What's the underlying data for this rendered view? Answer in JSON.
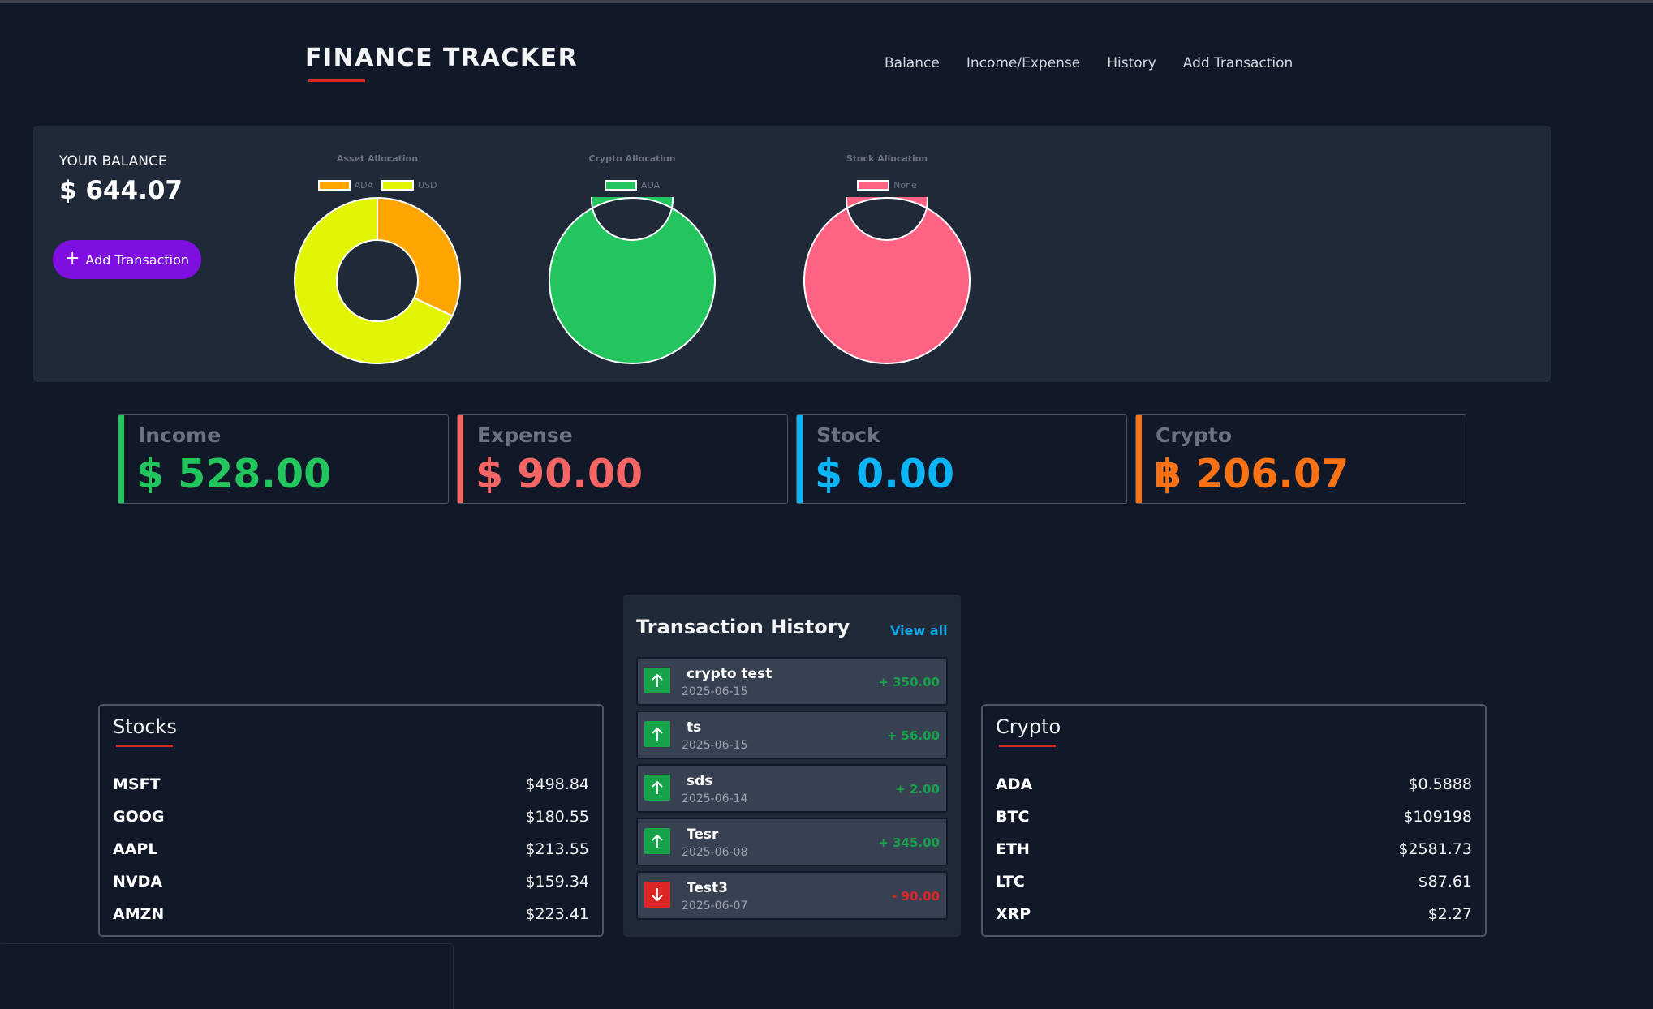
{
  "app": {
    "title": "FINANCE TRACKER"
  },
  "nav": {
    "items": [
      "Balance",
      "Income/Expense",
      "History",
      "Add Transaction"
    ]
  },
  "balance": {
    "label": "YOUR BALANCE",
    "value": "$ 644.07",
    "add_button_icon": "plus-icon",
    "add_button_label": "Add Transaction",
    "add_button_color": "#7e0fe0"
  },
  "chart_data": [
    {
      "type": "pie",
      "title": "Asset Allocation",
      "labels": [
        "ADA",
        "USD"
      ],
      "values": [
        206.07,
        437.99
      ],
      "colors": [
        "#ffa500",
        "#e1f505"
      ],
      "style": "doughnut",
      "legend": "top"
    },
    {
      "type": "pie",
      "title": "Crypto Allocation",
      "labels": [
        "ADA"
      ],
      "values": [
        206.07
      ],
      "colors": [
        "#22c55e"
      ],
      "style": "doughnut",
      "legend": "top"
    },
    {
      "type": "pie",
      "title": "Stock Allocation",
      "labels": [
        "None"
      ],
      "values": [
        1
      ],
      "colors": [
        "#ff6384"
      ],
      "style": "doughnut",
      "legend": "top"
    }
  ],
  "stats": [
    {
      "label": "Income",
      "value": "$ 528.00",
      "color": "#22c55e"
    },
    {
      "label": "Expense",
      "value": "$ 90.00",
      "color": "#f56565"
    },
    {
      "label": "Stock",
      "value": "$ 0.00",
      "color": "#0ab4f5"
    },
    {
      "label": "Crypto",
      "value": "฿ 206.07",
      "color": "#f97316"
    }
  ],
  "transactions": {
    "title": "Transaction History",
    "view_all": "View all",
    "items": [
      {
        "name": "crypto test",
        "date": "2025-06-15",
        "amount": "+ 350.00",
        "direction": "up",
        "icon": "arrow-up-icon"
      },
      {
        "name": "ts",
        "date": "2025-06-15",
        "amount": "+ 56.00",
        "direction": "up",
        "icon": "arrow-up-icon"
      },
      {
        "name": "sds",
        "date": "2025-06-14",
        "amount": "+ 2.00",
        "direction": "up",
        "icon": "arrow-up-icon"
      },
      {
        "name": "Tesr",
        "date": "2025-06-08",
        "amount": "+ 345.00",
        "direction": "up",
        "icon": "arrow-up-icon"
      },
      {
        "name": "Test3",
        "date": "2025-06-07",
        "amount": "- 90.00",
        "direction": "down",
        "icon": "arrow-down-icon"
      }
    ]
  },
  "stocks": {
    "title": "Stocks",
    "rows": [
      {
        "symbol": "MSFT",
        "price": "$498.84"
      },
      {
        "symbol": "GOOG",
        "price": "$180.55"
      },
      {
        "symbol": "AAPL",
        "price": "$213.55"
      },
      {
        "symbol": "NVDA",
        "price": "$159.34"
      },
      {
        "symbol": "AMZN",
        "price": "$223.41"
      }
    ]
  },
  "crypto": {
    "title": "Crypto",
    "rows": [
      {
        "symbol": "ADA",
        "price": "$0.5888"
      },
      {
        "symbol": "BTC",
        "price": "$109198"
      },
      {
        "symbol": "ETH",
        "price": "$2581.73"
      },
      {
        "symbol": "LTC",
        "price": "$87.61"
      },
      {
        "symbol": "XRP",
        "price": "$2.27"
      }
    ]
  },
  "colors": {
    "accent_underline": "#dc2626",
    "income_green": "#16a34a",
    "expense_red": "#dc2626",
    "link_blue": "#0ea5e9"
  }
}
